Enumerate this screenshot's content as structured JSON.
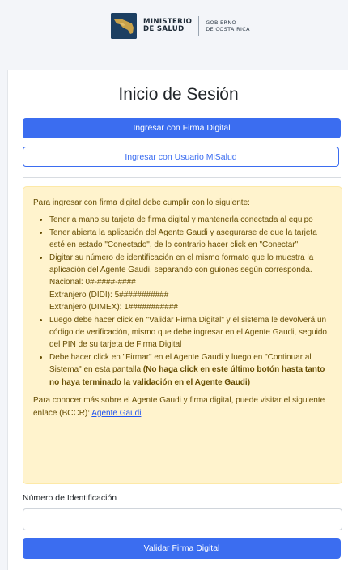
{
  "header": {
    "logo_main_line1": "MINISTERIO",
    "logo_main_line2": "DE SALUD",
    "logo_sub_line1": "GOBIERNO",
    "logo_sub_line2": "DE COSTA RICA"
  },
  "login": {
    "title": "Inicio de Sesión",
    "firma_button": "Ingresar con Firma Digital",
    "usuario_button": "Ingresar con Usuario MiSalud"
  },
  "instructions": {
    "intro": "Para ingresar con firma digital debe cumplir con lo siguiente:",
    "item1": "Tener a mano su tarjeta de firma digital y mantenerla conectada al equipo",
    "item2": "Tener abierta la aplicación del Agente Gaudi y asegurarse de que la tarjeta esté en estado \"Conectado\", de lo contrario hacer click en \"Conectar\"",
    "item3_text": "Digitar su número de identificación en el mismo formato que lo muestra la aplicación del Agente Gaudi, separando con guiones según corresponda.",
    "item3_nacional": "Nacional: 0#-####-####",
    "item3_didi": "Extranjero (DIDI): 5###########",
    "item3_dimex": "Extranjero (DIMEX): 1###########",
    "item4": "Luego debe hacer click en \"Validar Firma Digital\" y el sistema le devolverá un código de verificación, mismo que debe ingresar en el Agente Gaudi, seguido del PIN de su tarjeta de Firma Digital",
    "item5_text": "Debe hacer click en \"Firmar\" en el Agente Gaudi y luego en \"Continuar al Sistema\" en esta pantalla",
    "item5_bold": "(No haga click en este último botón hasta tanto no haya terminado la validación en el Agente Gaudi)",
    "more_info": "Para conocer más sobre el Agente Gaudi y firma digital, puede visitar el siguiente enlace (BCCR):",
    "link": "Agente Gaudi"
  },
  "form": {
    "id_label": "Número de Identificación",
    "id_value": "",
    "validate_button": "Validar Firma Digital"
  },
  "colors": {
    "primary": "#3b6df0",
    "alert_bg": "#fff3cd",
    "alert_text": "#664d03",
    "logo_navy": "#1c3f62",
    "logo_gold": "#c9a24a"
  }
}
